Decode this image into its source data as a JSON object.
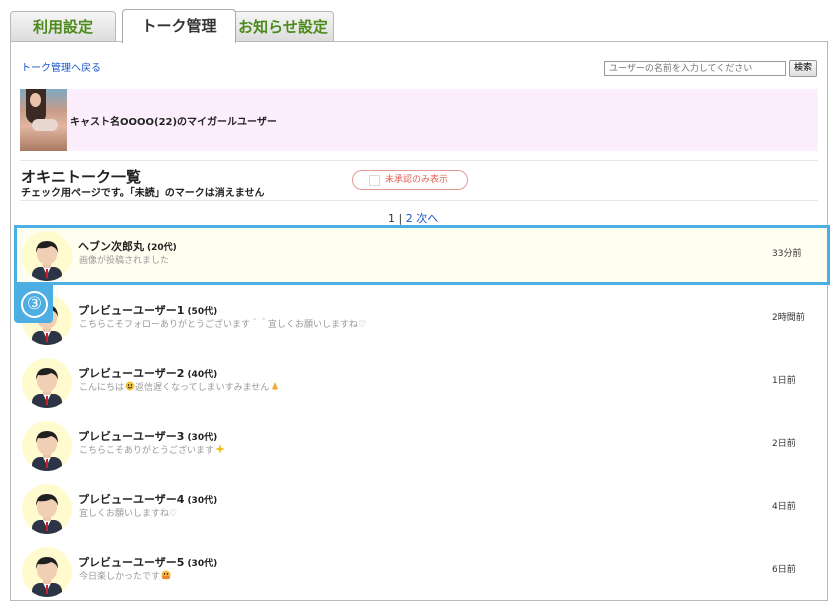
{
  "tabs": [
    {
      "label": "利用設定"
    },
    {
      "label": "トーク管理"
    },
    {
      "label": "お知らせ設定"
    }
  ],
  "back_link": "トーク管理へ戻る",
  "search": {
    "placeholder": "ユーザーの名前を入力してください",
    "button": "検索"
  },
  "cast_banner": "キャスト名OOOO(22)のマイガールユーザー",
  "list": {
    "title": "オキニトーク一覧",
    "subtitle": "チェック用ページです。「未読」のマークは消えません",
    "filter_label": "未承認のみ表示"
  },
  "pager": {
    "current": "1",
    "separator": "|",
    "page2": "2",
    "next": "次へ"
  },
  "step_badge": "3",
  "users": [
    {
      "name": "ヘブン次郎丸",
      "age": "(20代)",
      "message": "画像が投稿されました",
      "time": "33分前",
      "emoji": ""
    },
    {
      "name": "プレビューユーザー1",
      "age": "(50代)",
      "message": "こちらこそフォローありがとうございます＾＾宜しくお願いしますね♡",
      "time": "2時間前",
      "emoji": ""
    },
    {
      "name": "プレビューユーザー2",
      "age": "(40代)",
      "message": "こんにちは",
      "message2": "返信遅くなってしまいすみません",
      "time": "1日前",
      "emoji": "smile"
    },
    {
      "name": "プレビューユーザー3",
      "age": "(30代)",
      "message": "こちらこそありがとうございます",
      "time": "2日前",
      "emoji": "sparkle"
    },
    {
      "name": "プレビューユーザー4",
      "age": "(30代)",
      "message": "宜しくお願いしますね♡",
      "time": "4日前",
      "emoji": ""
    },
    {
      "name": "プレビューユーザー5",
      "age": "(30代)",
      "message": "今日楽しかったです",
      "time": "6日前",
      "emoji": "hug"
    }
  ],
  "colors": {
    "highlight": "#4daee4",
    "tab_green": "#4c8a1c",
    "banner_bg": "#fceefc",
    "link": "#1a56c8",
    "filter": "#e0625a"
  }
}
